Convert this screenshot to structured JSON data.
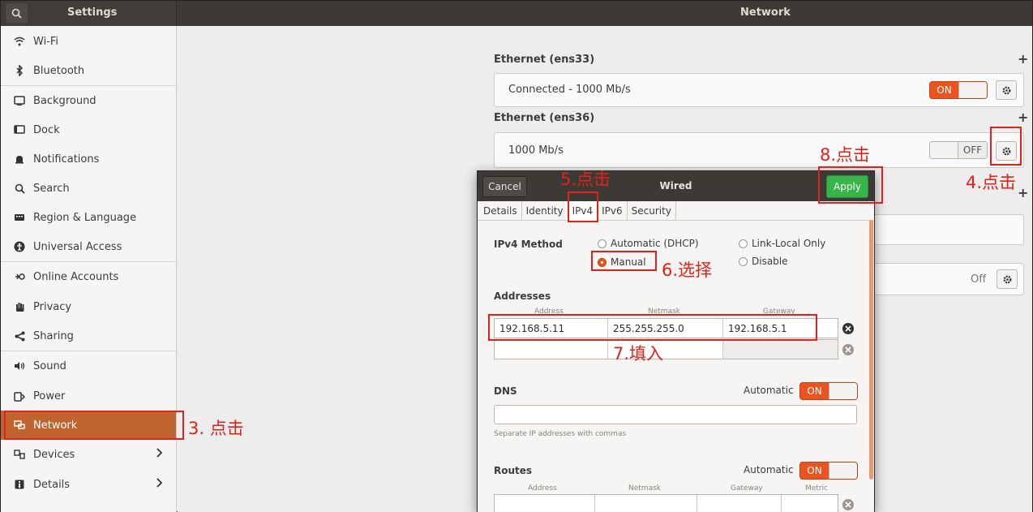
{
  "header": {
    "left_title": "Settings",
    "main_title": "Network"
  },
  "sidebar": {
    "items": [
      {
        "label": "Wi-Fi",
        "icon": "wifi-icon"
      },
      {
        "label": "Bluetooth",
        "icon": "bluetooth-icon"
      },
      {
        "label": "Background",
        "icon": "background-icon"
      },
      {
        "label": "Dock",
        "icon": "dock-icon"
      },
      {
        "label": "Notifications",
        "icon": "bell-icon"
      },
      {
        "label": "Search",
        "icon": "search-icon"
      },
      {
        "label": "Region & Language",
        "icon": "keyboard-icon"
      },
      {
        "label": "Universal Access",
        "icon": "accessibility-icon"
      },
      {
        "label": "Online Accounts",
        "icon": "accounts-icon"
      },
      {
        "label": "Privacy",
        "icon": "hand-icon"
      },
      {
        "label": "Sharing",
        "icon": "share-icon"
      },
      {
        "label": "Sound",
        "icon": "speaker-icon"
      },
      {
        "label": "Power",
        "icon": "power-icon"
      },
      {
        "label": "Network",
        "icon": "network-icon"
      },
      {
        "label": "Devices",
        "icon": "devices-icon"
      },
      {
        "label": "Details",
        "icon": "info-icon"
      }
    ]
  },
  "network": {
    "eth1_title": "Ethernet (ens33)",
    "eth1_status": "Connected - 1000 Mb/s",
    "eth1_switch": "ON",
    "eth2_title": "Ethernet (ens36)",
    "eth2_status": "1000 Mb/s",
    "eth2_switch": "OFF",
    "proxy_status": "Off",
    "plus": "+"
  },
  "dialog": {
    "cancel": "Cancel",
    "title": "Wired",
    "apply": "Apply",
    "tabs": [
      "Details",
      "Identity",
      "IPv4",
      "IPv6",
      "Security"
    ],
    "ipv4_method_label": "IPv4 Method",
    "methods": {
      "automatic": "Automatic (DHCP)",
      "link_local": "Link-Local Only",
      "manual": "Manual",
      "disable": "Disable"
    },
    "addresses_label": "Addresses",
    "col_address": "Address",
    "col_netmask": "Netmask",
    "col_gateway": "Gateway",
    "col_metric": "Metric",
    "address": "192.168.5.11",
    "netmask": "255.255.255.0",
    "gateway": "192.168.5.1",
    "dns_label": "DNS",
    "automatic_label": "Automatic",
    "on": "ON",
    "dns_hint": "Separate IP addresses with commas",
    "routes_label": "Routes"
  },
  "annotations": {
    "a3": "3. 点击",
    "a4": "4.点击",
    "a5": "5.点击",
    "a6": "6.选择",
    "a7": "7.填入",
    "a8": "8.点击"
  },
  "colors": {
    "accent": "#e95420",
    "apply": "#38b44a",
    "annotation": "#e0221b",
    "header": "#3d3a36",
    "sidebar_active": "#c0642f"
  }
}
